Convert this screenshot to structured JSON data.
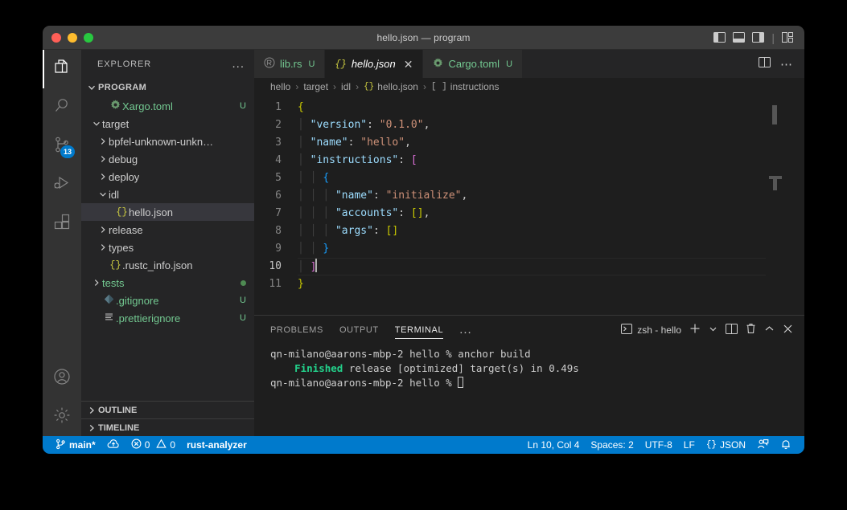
{
  "window": {
    "title": "hello.json — program",
    "traffic_lights": [
      "close",
      "minimize",
      "zoom"
    ],
    "layout_icons": [
      "toggle-primary-sidebar",
      "toggle-panel",
      "toggle-secondary-sidebar",
      "customize-layout"
    ]
  },
  "activitybar": {
    "items": [
      {
        "name": "explorer",
        "icon": "files-icon",
        "active": true,
        "badge": ""
      },
      {
        "name": "search",
        "icon": "search-icon",
        "active": false,
        "badge": ""
      },
      {
        "name": "source-control",
        "icon": "source-control-icon",
        "active": false,
        "badge": "13"
      },
      {
        "name": "run-and-debug",
        "icon": "debug-icon",
        "active": false,
        "badge": ""
      },
      {
        "name": "extensions",
        "icon": "extensions-icon",
        "active": false,
        "badge": ""
      }
    ],
    "bottom_items": [
      {
        "name": "accounts",
        "icon": "account-icon"
      },
      {
        "name": "manage",
        "icon": "gear-icon"
      }
    ]
  },
  "sidebar": {
    "header": "EXPLORER",
    "more_actions": "...",
    "section_title": "PROGRAM",
    "tree": [
      {
        "label": "Xargo.toml",
        "icon": "toml-gear-icon",
        "indent": 2,
        "chevron": "",
        "color": "green",
        "trail": "U",
        "selected": false
      },
      {
        "label": "target",
        "icon": "",
        "indent": 1,
        "chevron": "down",
        "color": "normal",
        "trail": "",
        "selected": false
      },
      {
        "label": "bpfel-unknown-unkn…",
        "icon": "",
        "indent": 2,
        "chevron": "right",
        "color": "normal",
        "trail": "",
        "selected": false
      },
      {
        "label": "debug",
        "icon": "",
        "indent": 2,
        "chevron": "right",
        "color": "normal",
        "trail": "",
        "selected": false
      },
      {
        "label": "deploy",
        "icon": "",
        "indent": 2,
        "chevron": "right",
        "color": "normal",
        "trail": "",
        "selected": false
      },
      {
        "label": "idl",
        "icon": "",
        "indent": 2,
        "chevron": "down",
        "color": "normal",
        "trail": "",
        "selected": false
      },
      {
        "label": "hello.json",
        "icon": "json-icon",
        "indent": 3,
        "chevron": "",
        "color": "normal",
        "trail": "",
        "selected": true
      },
      {
        "label": "release",
        "icon": "",
        "indent": 2,
        "chevron": "right",
        "color": "normal",
        "trail": "",
        "selected": false
      },
      {
        "label": "types",
        "icon": "",
        "indent": 2,
        "chevron": "right",
        "color": "normal",
        "trail": "",
        "selected": false
      },
      {
        "label": ".rustc_info.json",
        "icon": "json-icon",
        "indent": 2,
        "chevron": "",
        "color": "normal",
        "trail": "",
        "selected": false
      },
      {
        "label": "tests",
        "icon": "",
        "indent": 1,
        "chevron": "right",
        "color": "green",
        "trail": "dot",
        "selected": false
      },
      {
        "label": ".gitignore",
        "icon": "git-icon",
        "indent": 1,
        "chevron": "",
        "color": "green",
        "trail": "U",
        "selected": false
      },
      {
        "label": ".prettierignore",
        "icon": "lines-icon",
        "indent": 1,
        "chevron": "",
        "color": "green",
        "trail": "U",
        "selected": false
      }
    ],
    "bottom_sections": [
      "OUTLINE",
      "TIMELINE"
    ]
  },
  "editor": {
    "tabs": [
      {
        "label": "lib.rs",
        "icon": "rust-icon",
        "badge": "U",
        "active": false,
        "closable": false
      },
      {
        "label": "hello.json",
        "icon": "json-icon",
        "badge": "",
        "active": true,
        "closable": true
      },
      {
        "label": "Cargo.toml",
        "icon": "toml-gear-icon",
        "badge": "U",
        "active": false,
        "closable": false
      }
    ],
    "tab_actions": [
      "split-editor-icon",
      "more-actions-icon"
    ],
    "breadcrumb": [
      "hello",
      "target",
      "idl",
      "hello.json",
      "instructions"
    ],
    "breadcrumb_json_icon": "{}",
    "breadcrumb_array_icon": "[ ]",
    "lines": [
      {
        "n": "1",
        "tokens": [
          {
            "t": "{",
            "c": "k-brace"
          }
        ],
        "indent": 0
      },
      {
        "n": "2",
        "tokens": [
          {
            "t": "\"version\"",
            "c": "k-key"
          },
          {
            "t": ": ",
            "c": "k-punc"
          },
          {
            "t": "\"0.1.0\"",
            "c": "k-str"
          },
          {
            "t": ",",
            "c": "k-punc"
          }
        ],
        "indent": 1
      },
      {
        "n": "3",
        "tokens": [
          {
            "t": "\"name\"",
            "c": "k-key"
          },
          {
            "t": ": ",
            "c": "k-punc"
          },
          {
            "t": "\"hello\"",
            "c": "k-str"
          },
          {
            "t": ",",
            "c": "k-punc"
          }
        ],
        "indent": 1
      },
      {
        "n": "4",
        "tokens": [
          {
            "t": "\"instructions\"",
            "c": "k-key"
          },
          {
            "t": ": ",
            "c": "k-punc"
          },
          {
            "t": "[",
            "c": "k-brace2"
          }
        ],
        "indent": 1
      },
      {
        "n": "5",
        "tokens": [
          {
            "t": "{",
            "c": "k-brace3"
          }
        ],
        "indent": 2
      },
      {
        "n": "6",
        "tokens": [
          {
            "t": "\"name\"",
            "c": "k-key"
          },
          {
            "t": ": ",
            "c": "k-punc"
          },
          {
            "t": "\"initialize\"",
            "c": "k-str"
          },
          {
            "t": ",",
            "c": "k-punc"
          }
        ],
        "indent": 3
      },
      {
        "n": "7",
        "tokens": [
          {
            "t": "\"accounts\"",
            "c": "k-key"
          },
          {
            "t": ": ",
            "c": "k-punc"
          },
          {
            "t": "[]",
            "c": "k-brace"
          },
          {
            "t": ",",
            "c": "k-punc"
          }
        ],
        "indent": 3
      },
      {
        "n": "8",
        "tokens": [
          {
            "t": "\"args\"",
            "c": "k-key"
          },
          {
            "t": ": ",
            "c": "k-punc"
          },
          {
            "t": "[]",
            "c": "k-brace"
          }
        ],
        "indent": 3
      },
      {
        "n": "9",
        "tokens": [
          {
            "t": "}",
            "c": "k-brace3"
          }
        ],
        "indent": 2
      },
      {
        "n": "10",
        "tokens": [
          {
            "t": "]",
            "c": "k-brace2"
          }
        ],
        "indent": 1,
        "current": true,
        "cursor": true
      },
      {
        "n": "11",
        "tokens": [
          {
            "t": "}",
            "c": "k-brace"
          }
        ],
        "indent": 0
      }
    ]
  },
  "panel": {
    "tabs": [
      "PROBLEMS",
      "OUTPUT",
      "TERMINAL"
    ],
    "active_tab": "TERMINAL",
    "more": "...",
    "terminal_name": "zsh - hello",
    "actions": [
      "new-terminal-icon",
      "terminal-dropdown-icon",
      "split-terminal-icon",
      "kill-terminal-icon",
      "maximize-panel-icon",
      "close-panel-icon"
    ],
    "terminal_lines": [
      {
        "prefix": "qn-milano@aarons-mbp-2 hello % ",
        "highlight": "",
        "rest": "anchor build"
      },
      {
        "prefix": "    ",
        "highlight": "Finished",
        "rest": " release [optimized] target(s) in 0.49s"
      },
      {
        "prefix": "qn-milano@aarons-mbp-2 hello % ",
        "highlight": "",
        "rest": "",
        "cursor": true
      }
    ]
  },
  "statusbar": {
    "branch": "main*",
    "sync_icon": "sync-cloud-icon",
    "errors": "0",
    "warnings": "0",
    "language_server": "rust-analyzer",
    "position": "Ln 10, Col 4",
    "spaces": "Spaces: 2",
    "encoding": "UTF-8",
    "eol": "LF",
    "language": "JSON",
    "language_icon": "{}",
    "feedback_icon": "feedback-icon",
    "bell_icon": "bell-icon",
    "accent_color": "#007acc"
  }
}
